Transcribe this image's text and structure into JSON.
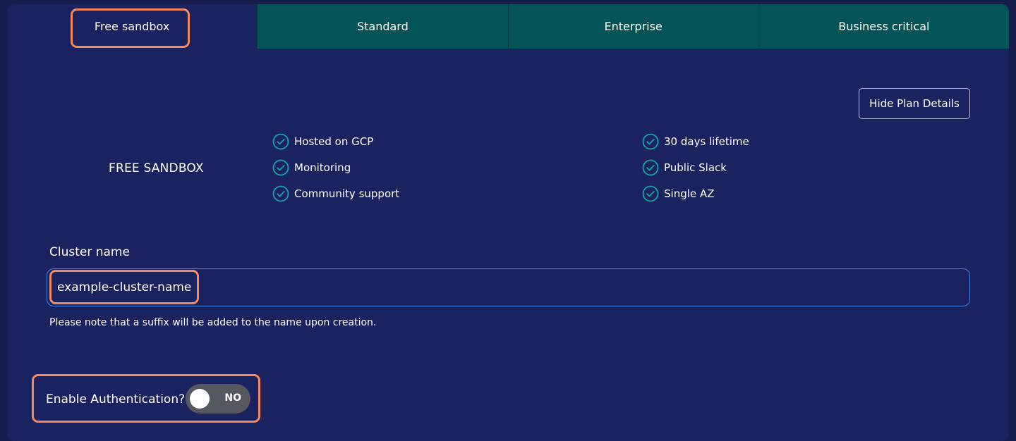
{
  "tabs": [
    {
      "label": "Free sandbox",
      "active": true
    },
    {
      "label": "Standard",
      "active": false
    },
    {
      "label": "Enterprise",
      "active": false
    },
    {
      "label": "Business critical",
      "active": false
    }
  ],
  "plan": {
    "hide_details_label": "Hide Plan Details",
    "name": "FREE SANDBOX",
    "features_col1": [
      "Hosted on GCP",
      "Monitoring",
      "Community support"
    ],
    "features_col2": [
      "30 days lifetime",
      "Public Slack",
      "Single AZ"
    ]
  },
  "cluster": {
    "label": "Cluster name",
    "value": "example-cluster-name",
    "help": "Please note that a suffix will be added to the name upon creation."
  },
  "auth": {
    "label": "Enable Authentication?",
    "state": "NO",
    "enabled": false
  },
  "colors": {
    "background": "#1a2360",
    "tab_inactive": "#045457",
    "highlight": "#f68a5a",
    "check": "#1aa3a8",
    "input_border": "#3f86e6"
  }
}
